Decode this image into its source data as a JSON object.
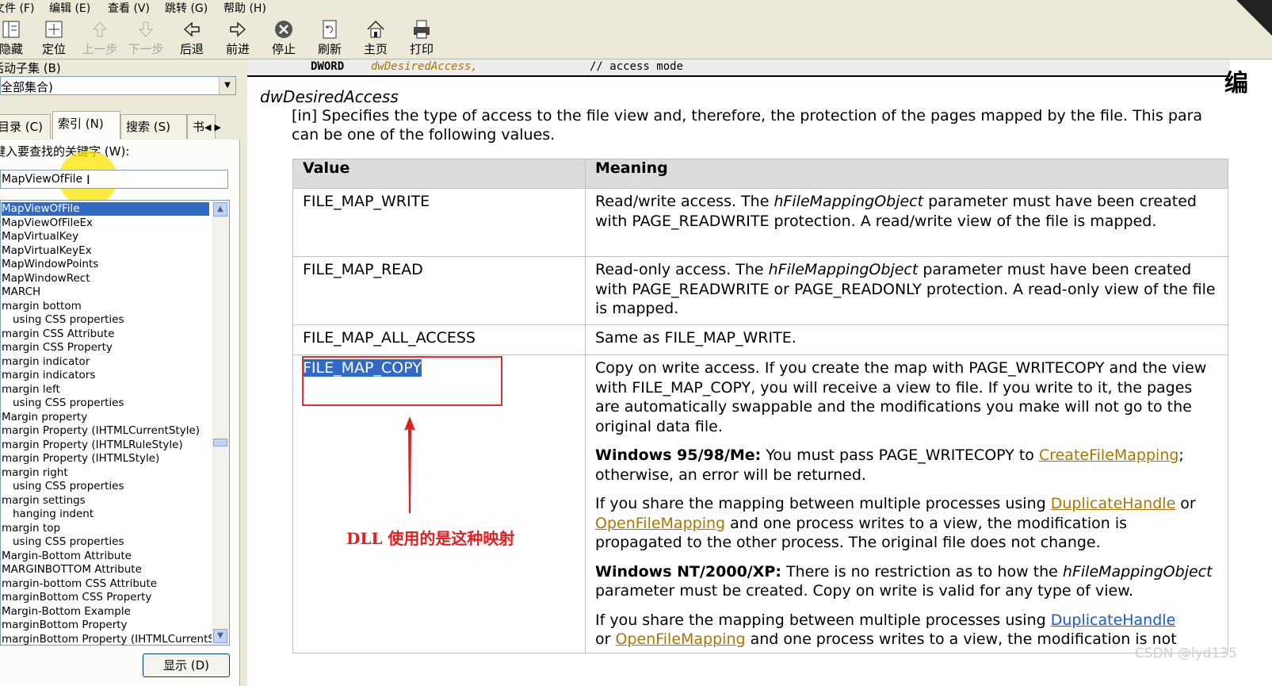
{
  "menu": [
    "文件(F)",
    "编辑(E)",
    "查看(V)",
    "跳转(G)",
    "帮助(H)"
  ],
  "menu_visible": [
    "文件 (F)",
    "编辑 (E)",
    "查看 (V)",
    "跳转 (G)",
    "帮助 (H)"
  ],
  "toolbar": {
    "hide": "隐藏",
    "locate": "定位",
    "prev": "上一步",
    "next": "下一步",
    "back": "后退",
    "forward": "前进",
    "stop": "停止",
    "refresh": "刷新",
    "home": "主页",
    "print": "打印"
  },
  "subset_label": "活动子集(B)",
  "subset_visible": "活动子集 (B)",
  "subset_value": "全部集合)",
  "tabs": {
    "contents": "目录(C)",
    "index": "索引(N)",
    "search": "搜索(S)",
    "fav": "书"
  },
  "tab_visible": {
    "contents": "目录 (C)",
    "index": "索引 (N)",
    "search": "搜索 (S)",
    "fav": "书"
  },
  "keyword_label": "键入要查找的关键字(W):",
  "keyword_visible": "键入要查找的关键字 (W):",
  "keyword_value": "MapViewOfFile",
  "index_items": [
    {
      "text": "MapViewOfFile",
      "indent": false,
      "selected": true
    },
    {
      "text": "MapViewOfFileEx",
      "indent": false
    },
    {
      "text": "MapVirtualKey",
      "indent": false
    },
    {
      "text": "MapVirtualKeyEx",
      "indent": false
    },
    {
      "text": "MapWindowPoints",
      "indent": false
    },
    {
      "text": "MapWindowRect",
      "indent": false
    },
    {
      "text": "MARCH",
      "indent": false
    },
    {
      "text": "margin bottom",
      "indent": false
    },
    {
      "text": "using CSS properties",
      "indent": true
    },
    {
      "text": "margin CSS Attribute",
      "indent": false
    },
    {
      "text": "margin CSS Property",
      "indent": false
    },
    {
      "text": "margin indicator",
      "indent": false
    },
    {
      "text": "margin indicators",
      "indent": false
    },
    {
      "text": "margin left",
      "indent": false
    },
    {
      "text": "using CSS properties",
      "indent": true
    },
    {
      "text": "Margin property",
      "indent": false
    },
    {
      "text": "margin Property (IHTMLCurrentStyle)",
      "indent": false
    },
    {
      "text": "margin Property (IHTMLRuleStyle)",
      "indent": false
    },
    {
      "text": "margin Property (IHTMLStyle)",
      "indent": false
    },
    {
      "text": "margin right",
      "indent": false
    },
    {
      "text": "using CSS properties",
      "indent": true
    },
    {
      "text": "margin settings",
      "indent": false
    },
    {
      "text": "hanging indent",
      "indent": true
    },
    {
      "text": "margin top",
      "indent": false
    },
    {
      "text": "using CSS properties",
      "indent": true
    },
    {
      "text": "Margin-Bottom Attribute",
      "indent": false
    },
    {
      "text": "MARGINBOTTOM Attribute",
      "indent": false
    },
    {
      "text": "margin-bottom CSS Attribute",
      "indent": false
    },
    {
      "text": "marginBottom CSS Property",
      "indent": false
    },
    {
      "text": "Margin-Bottom Example",
      "indent": false
    },
    {
      "text": "marginBottom Property",
      "indent": false
    },
    {
      "text": "marginBottom Property (IHTMLCurrentStyle)",
      "indent": false
    }
  ],
  "show_button": "显示(D)",
  "show_visible": "显示 (D)",
  "code_line": {
    "type": "DWORD",
    "name": "dwDesiredAccess,",
    "comment": "//  access mode"
  },
  "edge_char": "编",
  "param_name": "dwDesiredAccess",
  "param_desc_1": "[in] Specifies the type of access to the file view and, therefore, the protection of the pages mapped by the file. This para",
  "param_desc_2": "can be one of the following values.",
  "table": {
    "headers": [
      "Value",
      "Meaning"
    ],
    "rows": [
      {
        "value": "FILE_MAP_WRITE",
        "meaning_parts": [
          "Read/write access. The ",
          "hFileMappingObject",
          " parameter must have been created with PAGE_READWRITE protection. A read/write view of the file is mapped."
        ]
      },
      {
        "value": "FILE_MAP_READ",
        "meaning_parts": [
          "Read-only access. The ",
          "hFileMappingObject",
          " parameter must have been created with PAGE_READWRITE or PAGE_READONLY protection. A read-only view of the file is mapped."
        ]
      },
      {
        "value": "FILE_MAP_ALL_ACCESS",
        "meaning": "Same as FILE_MAP_WRITE."
      },
      {
        "value": "FILE_MAP_COPY",
        "meaning_p1": "Copy on write access. If you create the map with PAGE_WRITECOPY and the view with FILE_MAP_COPY, you will receive a view to file. If you write to it, the pages are automatically swappable and the modifications you make will not go to the original data file.",
        "win9x_bold": "Windows 95/98/Me:",
        "win9x_1": " You must pass PAGE_WRITECOPY to ",
        "win9x_link": "CreateFileMapping",
        "win9x_2": "; otherwise, an error will be returned.",
        "share1_a": "If you share the mapping between multiple processes using ",
        "share1_link1": "DuplicateHandle",
        "share1_b": " or ",
        "share1_link2": "OpenFileMapping",
        "share1_c": " and one process writes to a view, the modification is propagated to the other process. The original file does not change.",
        "nt_bold": "Windows NT/2000/XP:",
        "nt_1": " There is no restriction as to how the ",
        "nt_italic": "hFileMappingObject",
        "nt_2": " parameter must be created. Copy on write is valid for any type of view.",
        "share2_a": "If you share the mapping between multiple processes using ",
        "share2_link1": "DuplicateHandle",
        "share2_b": " or ",
        "share2_link2": "OpenFileMapping",
        "share2_c": " and one process writes to a view, the modification is not"
      }
    ]
  },
  "annotation": "DLL 使用的是这种映射",
  "watermark": "CSDN @lyd135",
  "colors": {
    "annotation": "#e02020",
    "selection": "#316ac5",
    "link": "#aa7500"
  }
}
